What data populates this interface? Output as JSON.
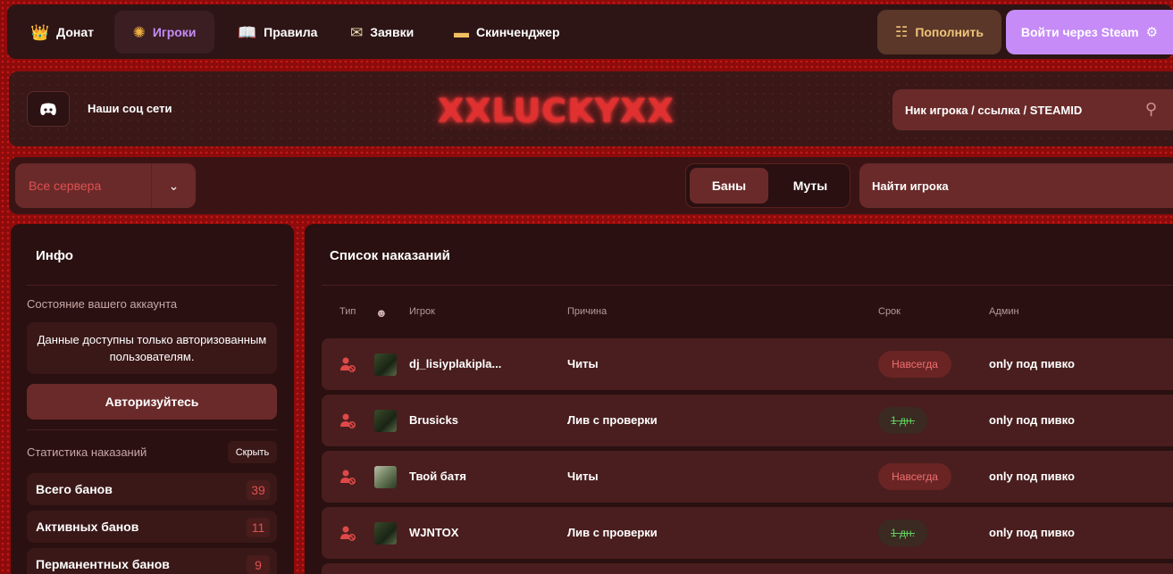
{
  "nav": {
    "items": [
      {
        "label": "Донат",
        "icon": "crown-icon",
        "glyph": "👑",
        "active": false
      },
      {
        "label": "Игроки",
        "icon": "laurel-icon",
        "glyph": "✺",
        "active": true
      },
      {
        "label": "Правила",
        "icon": "book-icon",
        "glyph": "📖",
        "active": false
      },
      {
        "label": "Заявки",
        "icon": "envelope-icon",
        "glyph": "✉",
        "active": false
      },
      {
        "label": "Скинченджер",
        "icon": "pistol-icon",
        "glyph": "▬",
        "active": false
      }
    ],
    "topup_label": "Пополнить",
    "steam_label": "Войти через Steam"
  },
  "header": {
    "social_label": "Наши соц сети",
    "logo_text": "XXLUCKYXX",
    "search_placeholder": "Ник игрока / ссылка / STEAMID"
  },
  "filters": {
    "server_select": "Все сервера",
    "tabs": [
      "Баны",
      "Муты"
    ],
    "active_tab": "Баны",
    "find_player_placeholder": "Найти игрока"
  },
  "info": {
    "title": "Инфо",
    "account_state_label": "Состояние вашего аккаунта",
    "account_message": "Данные доступны только авторизованным пользователям.",
    "auth_button": "Авторизуйтесь",
    "stats_label": "Статистика наказаний",
    "hide_button": "Скрыть",
    "stats": [
      {
        "label": "Всего банов",
        "value": "39"
      },
      {
        "label": "Активных банов",
        "value": "11"
      },
      {
        "label": "Перманентных банов",
        "value": "9"
      }
    ]
  },
  "list": {
    "title": "Список наказаний",
    "columns": {
      "type": "Тип",
      "player": "Игрок",
      "reason": "Причина",
      "term": "Срок",
      "admin": "Админ"
    },
    "rows": [
      {
        "player": "dj_lisiyplakipla...",
        "reason": "Читы",
        "term": "Навсегда",
        "term_kind": "forever",
        "admin": "only под пивко",
        "avatar": "dark"
      },
      {
        "player": "Brusicks",
        "reason": "Лив с проверки",
        "term": "1 дн.",
        "term_kind": "expired",
        "admin": "only под пивко",
        "avatar": "dark"
      },
      {
        "player": "Твой батя",
        "reason": "Читы",
        "term": "Навсегда",
        "term_kind": "forever",
        "admin": "only под пивко",
        "avatar": "light"
      },
      {
        "player": "WJNTOX",
        "reason": "Лив с проверки",
        "term": "1 дн.",
        "term_kind": "expired",
        "admin": "only под пивко",
        "avatar": "dark"
      }
    ]
  },
  "colors": {
    "accent_purple": "#c68bf6",
    "panel": "#2a1010",
    "row": "#4a1e1e",
    "danger": "#e05050"
  }
}
